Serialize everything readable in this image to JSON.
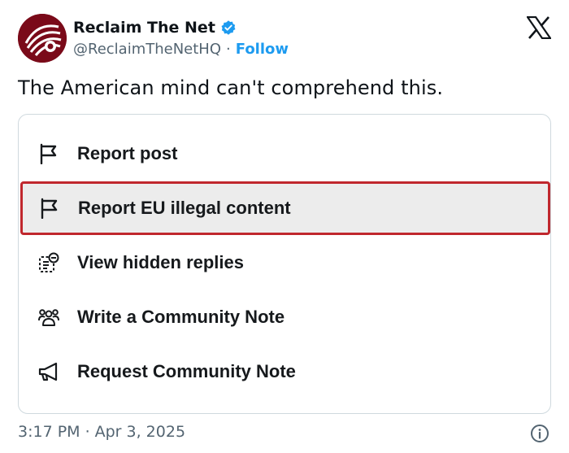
{
  "author": {
    "name": "Reclaim The Net",
    "handle": "@ReclaimTheNetHQ",
    "separator": "·",
    "follow_label": "Follow",
    "verified_icon": "verified-badge-icon",
    "avatar_color": "#7a0a19"
  },
  "platform_icon": "x-logo-icon",
  "tweet": {
    "text": "The American mind can't comprehend this."
  },
  "embedded_menu": {
    "items": [
      {
        "label": "Report post",
        "icon": "flag-icon",
        "highlighted": false
      },
      {
        "label": "Report EU illegal content",
        "icon": "flag-icon",
        "highlighted": true
      },
      {
        "label": "View hidden replies",
        "icon": "hidden-replies-icon",
        "highlighted": false
      },
      {
        "label": "Write a Community Note",
        "icon": "people-icon",
        "highlighted": false
      },
      {
        "label": "Request Community Note",
        "icon": "megaphone-icon",
        "highlighted": false
      }
    ],
    "highlight_color": "#c0272d"
  },
  "footer": {
    "time": "3:17 PM",
    "separator": "·",
    "date": "Apr 3, 2025",
    "info_icon": "info-icon"
  }
}
